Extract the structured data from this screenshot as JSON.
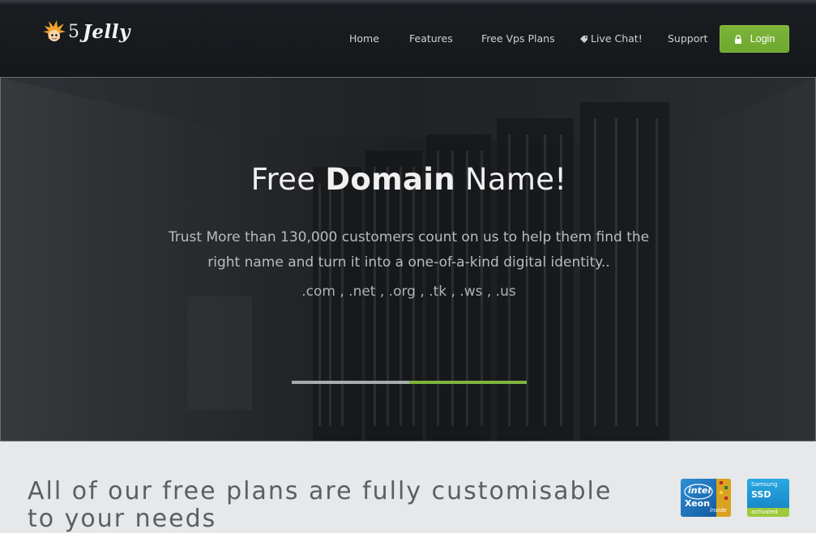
{
  "brand": {
    "number": "5",
    "name": "Jelly",
    "mascot_icon": "spiky-hair-mascot-icon"
  },
  "nav": {
    "items": [
      {
        "label": "Home"
      },
      {
        "label": "Features"
      },
      {
        "label": "Free Vps Plans"
      },
      {
        "label": "Live Chat!",
        "icon": "chat-tag-icon"
      },
      {
        "label": "Support"
      }
    ],
    "login": {
      "label": "Login",
      "icon": "lock-icon",
      "color": "#6ea82e"
    }
  },
  "hero": {
    "title_pre": "Free ",
    "title_bold": "Domain",
    "title_post": " Name!",
    "text": "Trust More than 130,000 customers count on us to help them find the right name and turn it into a one-of-a-kind digital identity..",
    "tlds": ".com , .net , .org , .tk , .ws , .us",
    "slider_progress": 0.5,
    "accent": "#7db53c"
  },
  "plans": {
    "heading": "All of our free plans are fully customisable to your needs",
    "badges": {
      "intel": {
        "brand": "intel",
        "product": "Xeon",
        "suffix": "inside"
      },
      "ssd": {
        "brand": "Samsung",
        "product": "SSD",
        "status": "activated"
      }
    }
  }
}
